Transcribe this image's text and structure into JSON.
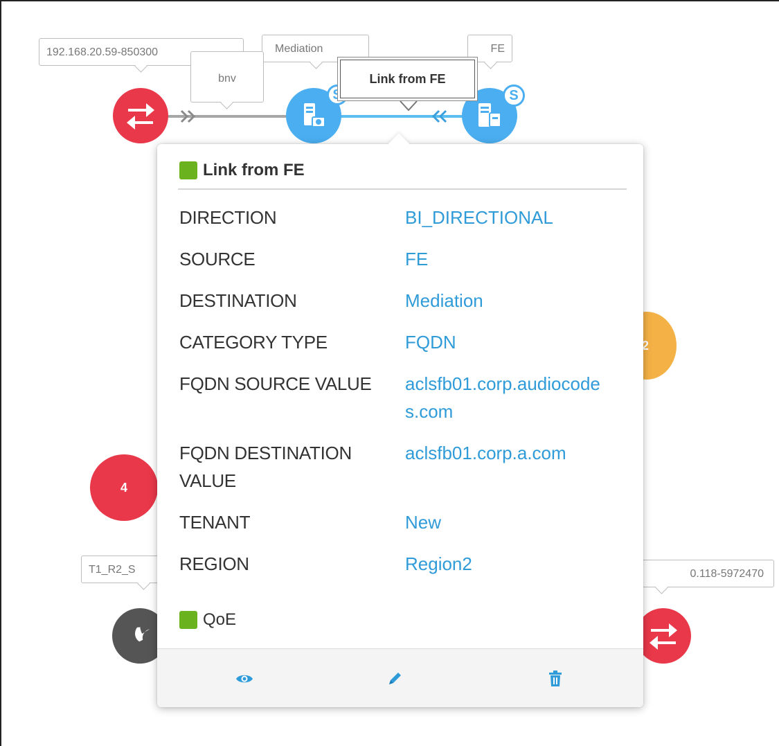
{
  "topology": {
    "labels": {
      "ip_top": "192.168.20.59-850300",
      "bnv": "bnv",
      "mediation": "Mediation",
      "fe": "FE",
      "t1": "T1_R2_S",
      "ip_bottom": "0.118-5972470"
    },
    "badges": {
      "left_count": "4",
      "right_count": "2"
    },
    "tooltip": "Link from FE",
    "colors": {
      "red_node": "#e9384a",
      "blue_node": "#4aaef0",
      "orange_node": "#f4b146",
      "dark_node": "#555555",
      "link_blue": "#5cbdf0",
      "link_gray": "#a6a6a6"
    }
  },
  "popup": {
    "title": "Link from FE",
    "status_color": "#6ab31f",
    "rows": [
      {
        "key": "DIRECTION",
        "value": "BI_DIRECTIONAL"
      },
      {
        "key": "SOURCE",
        "value": "FE"
      },
      {
        "key": "DESTINATION",
        "value": "Mediation"
      },
      {
        "key": "CATEGORY TYPE",
        "value": "FQDN"
      },
      {
        "key": "FQDN SOURCE VALUE",
        "value": "aclsfb01.corp.audiocodes.com"
      },
      {
        "key": "FQDN DESTINATION VALUE",
        "value": "aclsfb01.corp.a.com"
      },
      {
        "key": "TENANT",
        "value": "New"
      },
      {
        "key": "REGION",
        "value": "Region2"
      }
    ],
    "qoe_label": "QoE",
    "actions": [
      "eye-icon",
      "pencil-icon",
      "trash-icon"
    ]
  }
}
